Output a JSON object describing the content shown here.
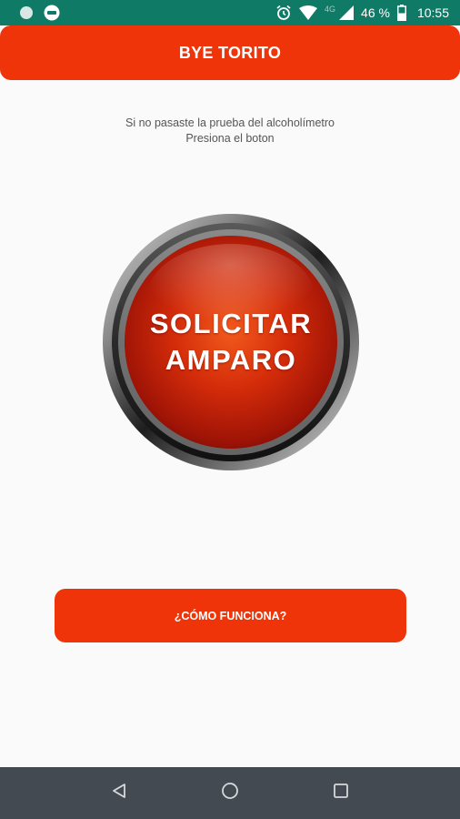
{
  "status_bar": {
    "network_label": "4G",
    "battery_percent": "46 %",
    "time": "10:55",
    "icons": [
      "notification-dot-icon",
      "app-icon",
      "alarm-icon",
      "wifi-icon",
      "signal-icon",
      "battery-icon"
    ]
  },
  "app_bar": {
    "title": "BYE TORITO"
  },
  "instruction": {
    "line1": "Si no pasaste la prueba del alcoholímetro",
    "line2": "Presiona el boton"
  },
  "main_button": {
    "line1": "SOLICITAR",
    "line2": "AMPARO"
  },
  "secondary_button": {
    "label": "¿CÓMO FUNCIONA?"
  },
  "nav_bar": {
    "icons": [
      "back-icon",
      "home-icon",
      "recents-icon"
    ]
  },
  "colors": {
    "status_bar": "#0f7a66",
    "accent": "#ee3408",
    "background": "#fafafa",
    "nav_bar": "#434a52"
  }
}
